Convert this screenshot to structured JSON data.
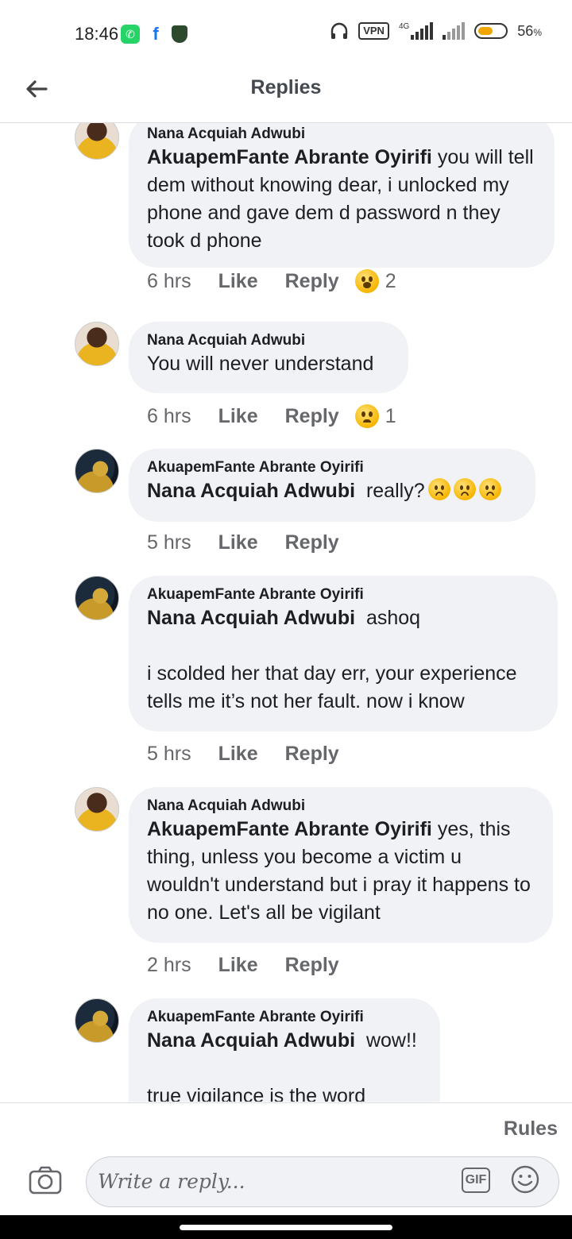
{
  "status_bar": {
    "time": "18:46",
    "vpn": "VPN",
    "network": "4G",
    "battery_percent": "56",
    "battery_suffix": "%",
    "battery_level": 0.56
  },
  "header": {
    "title": "Replies"
  },
  "comments": [
    {
      "author": "Nana Acquiah Adwubi",
      "mention": "AkuapemFante Abrante Oyirifi",
      "text": " you will tell dem without knowing dear, i unlocked my phone and gave dem d password n they took d phone",
      "time": "6 hrs",
      "like": "Like",
      "reply": "Reply",
      "reaction": {
        "icon": "wow-emoji-icon",
        "count": "2"
      }
    },
    {
      "author": "Nana Acquiah Adwubi",
      "text": "You will never understand",
      "time": "6 hrs",
      "like": "Like",
      "reply": "Reply",
      "reaction": {
        "icon": "sad-emoji-icon",
        "count": "1"
      }
    },
    {
      "author": "AkuapemFante Abrante Oyirifi",
      "mention": "Nana Acquiah Adwubi",
      "text": "  really?",
      "inline_emojis": [
        "frown-emoji-icon",
        "frown-emoji-icon",
        "frown-emoji-icon"
      ],
      "time": "5 hrs",
      "like": "Like",
      "reply": "Reply"
    },
    {
      "author": "AkuapemFante Abrante Oyirifi",
      "mention": "Nana Acquiah Adwubi",
      "text_line1": "  ashoq",
      "text_para": "i scolded her that day err, your experience tells me it’s not her fault. now i know",
      "time": "5 hrs",
      "like": "Like",
      "reply": "Reply"
    },
    {
      "author": "Nana Acquiah Adwubi",
      "mention": "AkuapemFante Abrante Oyirifi",
      "text": " yes, this thing, unless you become a victim u wouldn't understand but i pray it happens to no one. Let's all be vigilant",
      "time": "2 hrs",
      "like": "Like",
      "reply": "Reply"
    },
    {
      "author": "AkuapemFante Abrante Oyirifi",
      "mention": "Nana Acquiah Adwubi",
      "text_line1": "  wow!!",
      "text_para": "true vigilance is the word"
    }
  ],
  "footer": {
    "rules": "Rules",
    "reply_placeholder": "Write a reply...",
    "gif_label": "GIF"
  },
  "colors": {
    "bubble": "#f0f2f5",
    "meta_text": "#65676b",
    "body_text": "#1c1e21",
    "battery": "#f0a500",
    "whatsapp": "#25d366",
    "facebook": "#1877f2"
  }
}
